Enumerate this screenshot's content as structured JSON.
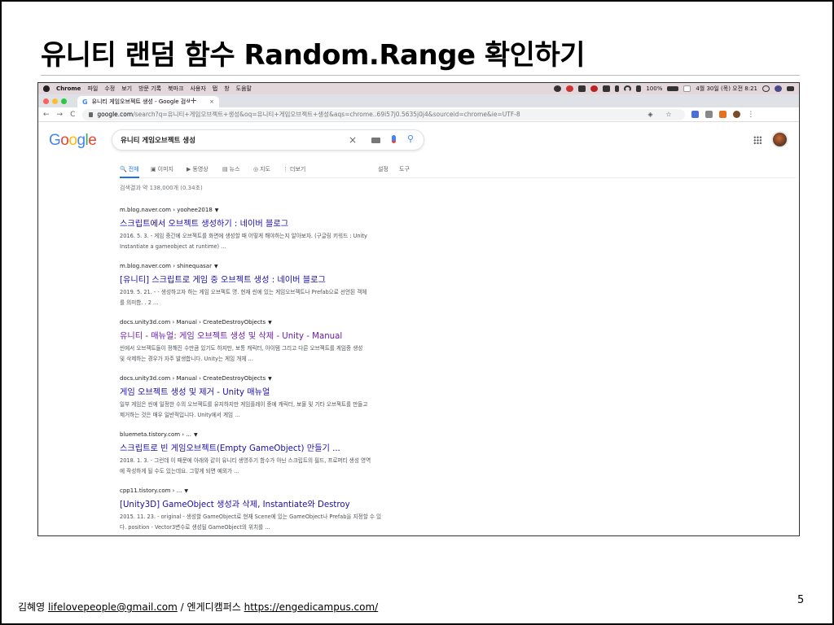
{
  "slide": {
    "title": "유니티 랜덤 함수 Random.Range 확인하기",
    "page_number": "5",
    "footer": {
      "author": "김혜영",
      "email": "lifelovepeople@gmail.com",
      "separator": "/",
      "org": "엔게디캠퍼스",
      "url": "https://engedicampus.com/"
    }
  },
  "menubar": {
    "app": "Chrome",
    "items": [
      "파일",
      "수정",
      "보기",
      "방문 기록",
      "북마크",
      "사용자",
      "탭",
      "창",
      "도움말"
    ],
    "battery": "100%",
    "datetime": "4월 30일 (목) 오전 8:21"
  },
  "browser": {
    "tab_title": "유니티 게임오브젝트 생성 - Google 검색",
    "tab_close": "×",
    "new_tab": "+",
    "nav": {
      "back": "←",
      "forward": "→",
      "reload": "C"
    },
    "url_host": "google.com",
    "url_path": "/search?q=유니티+게임오브젝트+생성&oq=유니티+게임오브젝트+생성&aqs=chrome..69i57j0.5635j0j4&sourceid=chrome&ie=UTF-8",
    "more": "⋮"
  },
  "google": {
    "logo": "Google",
    "query": "유니티 게임오브젝트 생성",
    "clear": "×",
    "tabs": [
      {
        "icon": "🔍",
        "label": "전체"
      },
      {
        "icon": "▣",
        "label": "이미지"
      },
      {
        "icon": "▶",
        "label": "동영상"
      },
      {
        "icon": "▤",
        "label": "뉴스"
      },
      {
        "icon": "◎",
        "label": "지도"
      },
      {
        "icon": "⋮",
        "label": "더보기"
      }
    ],
    "settings": "설정",
    "tools": "도구",
    "stats": "검색결과 약 138,000개 (0.34초)",
    "results": [
      {
        "url": "m.blog.naver.com › yoohee2018",
        "title": "스크립트에서 오브젝트 생성하기 : 네이버 블로그",
        "snippet1": "2016. 5. 3. - 게임 중간에 오브젝트를 화면에 생성할 때 어떻게 해야하는지 알아보자. (구글링 키워드 : Unity",
        "snippet2": "Instantiate a gameobject at runtime) ..."
      },
      {
        "url": "m.blog.naver.com › shinequasar",
        "title": "[유니티] 스크립트로 게임 중 오브젝트 생성 : 네이버 블로그",
        "snippet1": "2019. 5. 21. - - 생성하고자 하는 게임 오브젝트 명. 현재 씬에 있는 게임오브젝트나 Prefab으로 선언된 객체",
        "snippet2": "를 의미함. . 2 ..."
      },
      {
        "url": "docs.unity3d.com › Manual › CreateDestroyObjects",
        "title": "유니티 - 매뉴얼: 게임 오브젝트 생성 및 삭제 - Unity - Manual",
        "snippet1": "씬에서 오브젝트들이 정해진 수만큼 있기도 하지만, 보통 캐릭터, 아이템 그리고 다른 오브젝트를 게임중 생성",
        "snippet2": "및 삭제하는 경우가 자주 발생합니다. Unity는 게임 개체 ..."
      },
      {
        "url": "docs.unity3d.com › Manual › CreateDestroyObjects",
        "title": "게임 오브젝트 생성 및 제거 - Unity 매뉴얼",
        "snippet1": "일부 게임은 씬에 일정한 수의 오브젝트를 유지하지만 게임플레이 중에 캐릭터, 보물 및 기타 오브젝트를 만들고",
        "snippet2": "제거하는 것은 매우 일반적입니다. Unity에서 게임 ..."
      },
      {
        "url": "bluemeta.tistory.com › ...",
        "title": "스크립트로 빈 게임오브젝트(Empty GameObject) 만들기 ...",
        "snippet1": "2018. 1. 3. - 그런데 이 때문에 아래와 같이 유니티 생명주기 함수가 아닌 스크립트의 필드, 프로퍼티 생성 영역",
        "snippet2": "에 작성하게 될 수도 있는데요. 그렇게 되면 예외가 ..."
      },
      {
        "url": "cpp11.tistory.com › ...",
        "title": "[Unity3D] GameObject 생성과 삭제, Instantiate와 Destroy",
        "snippet1": "2015. 11. 23. - original - 생성할 GameObject로 현재 Scene에 있는 GameObject나 Prefab을 지정할 수 있",
        "snippet2": "다. position - Vector3변수로 생성될 GameObject의 위치를 ..."
      }
    ]
  },
  "colors": {
    "link": "#1a0dab",
    "visited": "#681da8",
    "active_tab": "#1a73e8",
    "menubar_bg": "#e4d7db"
  }
}
